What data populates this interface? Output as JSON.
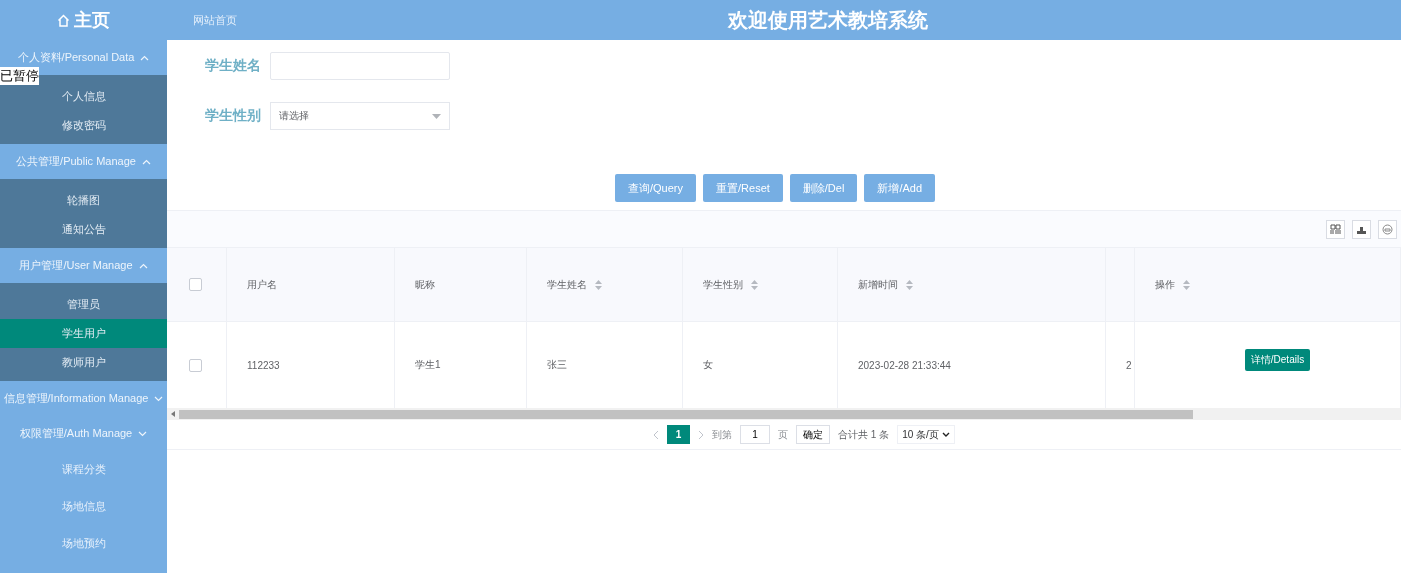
{
  "header": {
    "home": "主页",
    "site_link": "网站首页",
    "title": "欢迎使用艺术教培系统"
  },
  "player_status": "已暂停",
  "sidebar": [
    {
      "kind": "group",
      "label": "个人资料/Personal Data",
      "expanded": true,
      "children": [
        {
          "label": "个人信息",
          "selected": false
        },
        {
          "label": "修改密码",
          "selected": false
        }
      ]
    },
    {
      "kind": "group",
      "label": "公共管理/Public Manage",
      "expanded": true,
      "children": [
        {
          "label": "轮播图",
          "selected": false
        },
        {
          "label": "通知公告",
          "selected": false
        }
      ]
    },
    {
      "kind": "group",
      "label": "用户管理/User Manage",
      "expanded": true,
      "children": [
        {
          "label": "管理员",
          "selected": false
        },
        {
          "label": "学生用户",
          "selected": true
        },
        {
          "label": "教师用户",
          "selected": false
        }
      ]
    },
    {
      "kind": "group",
      "label": "信息管理/Information Manage",
      "expanded": false
    },
    {
      "kind": "group",
      "label": "权限管理/Auth Manage",
      "expanded": false
    },
    {
      "kind": "item",
      "label": "课程分类"
    },
    {
      "kind": "item",
      "label": "场地信息"
    },
    {
      "kind": "item",
      "label": "场地预约"
    }
  ],
  "search": [
    {
      "kind": "input",
      "label": "学生姓名"
    },
    {
      "kind": "select",
      "label": "学生性别",
      "placeholder": "请选择"
    }
  ],
  "buttons": [
    "查询/Query",
    "重置/Reset",
    "删除/Del",
    "新增/Add"
  ],
  "table": {
    "select_all_checked": false,
    "columns": [
      {
        "label": "用户名",
        "sortable": false
      },
      {
        "label": "昵称",
        "sortable": false
      },
      {
        "label": "学生姓名",
        "sortable": true
      },
      {
        "label": "学生性别",
        "sortable": true
      },
      {
        "label": "新增时间",
        "sortable": true
      },
      {
        "sortable": false
      },
      {
        "label": "操作",
        "sortable": true
      }
    ],
    "rows": [
      {
        "checked": false,
        "cells": [
          "112233",
          "学生1",
          "张三",
          "女",
          "2023-02-28 21:33:44",
          "2"
        ],
        "action": "详情/Details"
      }
    ]
  },
  "pagination": {
    "pages": [
      {
        "label": "1",
        "selected": true
      }
    ],
    "goto_label": "到第",
    "goto_value": "1",
    "page_unit": "页",
    "confirm": "确定",
    "total": "合计共 1 条",
    "page_size": "10 条/页"
  }
}
